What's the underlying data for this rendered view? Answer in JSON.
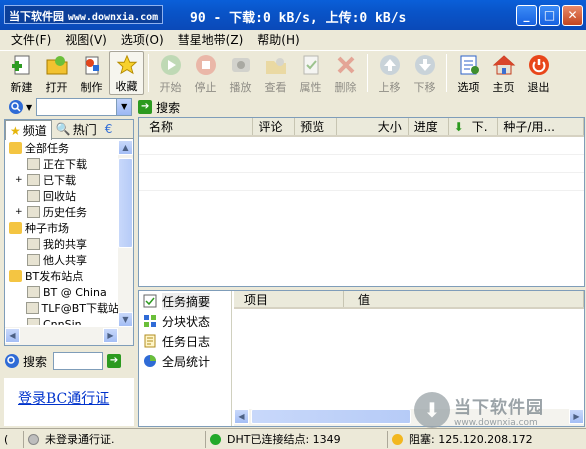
{
  "titlebar": {
    "logo_cn": "当下软件园",
    "logo_site": "www.downxia.com",
    "title": "90 - 下载:0 kB/s, 上传:0 kB/s",
    "min": "_",
    "max": "□",
    "close": "✕"
  },
  "menu": [
    "文件(F)",
    "视图(V)",
    "选项(O)",
    "彗星地带(Z)",
    "帮助(H)"
  ],
  "toolbar": {
    "buttons": [
      {
        "label": "新建",
        "icon": "new-icon",
        "disabled": false
      },
      {
        "label": "打开",
        "icon": "open-icon",
        "disabled": false
      },
      {
        "label": "制作",
        "icon": "make-icon",
        "disabled": false
      },
      {
        "label": "收藏",
        "icon": "favorite-star-icon",
        "disabled": false
      },
      {
        "label": "开始",
        "icon": "start-icon",
        "disabled": true
      },
      {
        "label": "停止",
        "icon": "stop-icon",
        "disabled": true
      },
      {
        "label": "播放",
        "icon": "play-icon",
        "disabled": true
      },
      {
        "label": "查看",
        "icon": "view-icon",
        "disabled": true
      },
      {
        "label": "属性",
        "icon": "properties-icon",
        "disabled": true
      },
      {
        "label": "删除",
        "icon": "delete-icon",
        "disabled": true
      },
      {
        "label": "上移",
        "icon": "move-up-icon",
        "disabled": true
      },
      {
        "label": "下移",
        "icon": "move-down-icon",
        "disabled": true
      },
      {
        "label": "选项",
        "icon": "options-icon",
        "disabled": false
      },
      {
        "label": "主页",
        "icon": "home-icon",
        "disabled": false
      },
      {
        "label": "退出",
        "icon": "exit-icon",
        "disabled": false
      }
    ]
  },
  "search": {
    "button_label": "搜索",
    "value": ""
  },
  "left": {
    "tabs": [
      "频道",
      "热门"
    ],
    "tree": [
      {
        "label": "全部任务",
        "level": 0,
        "expander": ""
      },
      {
        "label": "正在下载",
        "level": 1,
        "expander": ""
      },
      {
        "label": "已下载",
        "level": 1,
        "expander": "+"
      },
      {
        "label": "回收站",
        "level": 1,
        "expander": ""
      },
      {
        "label": "历史任务",
        "level": 1,
        "expander": "+"
      },
      {
        "label": "种子市场",
        "level": 0,
        "expander": ""
      },
      {
        "label": "我的共享",
        "level": 1,
        "expander": ""
      },
      {
        "label": "他人共享",
        "level": 1,
        "expander": ""
      },
      {
        "label": "BT发布站点",
        "level": 0,
        "expander": ""
      },
      {
        "label": "BT @ China",
        "level": 1,
        "expander": ""
      },
      {
        "label": "TLF@BT下载站",
        "level": 1,
        "expander": ""
      },
      {
        "label": "CnnSin",
        "level": 1,
        "expander": ""
      }
    ],
    "search_label": "搜索",
    "bc_link": "登录BC通行证"
  },
  "list": {
    "columns": [
      "名称",
      "评论",
      "预览",
      "大小",
      "进度",
      "下.",
      "种子/用..."
    ]
  },
  "detail": {
    "items": [
      "任务摘要",
      "分块状态",
      "任务日志",
      "全局统计"
    ],
    "columns": [
      "项目",
      "值"
    ]
  },
  "watermark": {
    "cn": "当下软件园",
    "url": "www.downxia.com"
  },
  "status": {
    "login": "未登录通行证.",
    "dht": "DHT已连接结点: 1349",
    "blocked": "阻塞: 125.120.208.172"
  },
  "colors": {
    "title_blue": "#0A5FD9",
    "panel_bg": "#ECE9D8",
    "link_blue": "#0033CC"
  }
}
